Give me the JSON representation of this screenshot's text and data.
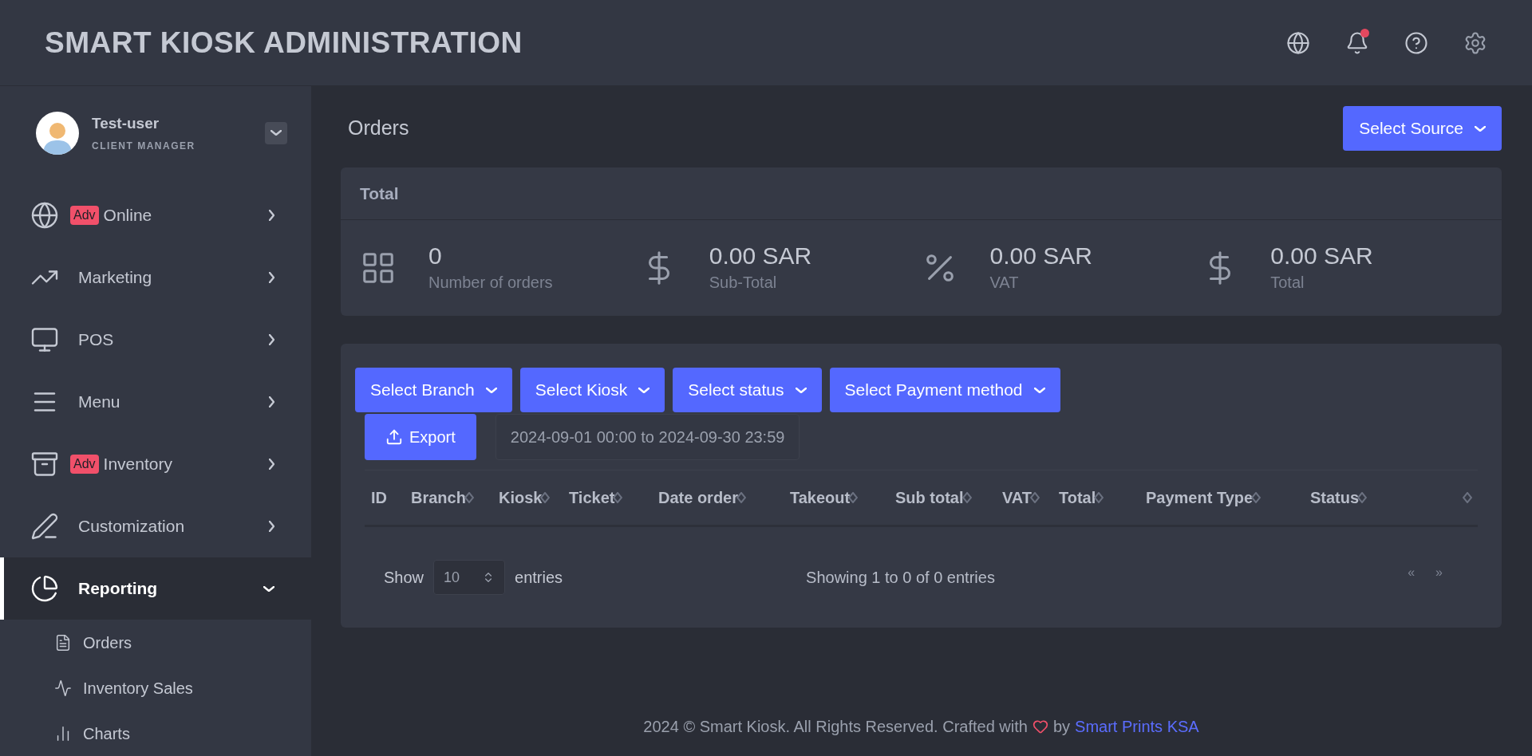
{
  "header": {
    "title": "SMART KIOSK ADMINISTRATION",
    "notification": true
  },
  "sidebar": {
    "user": {
      "name": "Test-user",
      "role": "CLIENT MANAGER"
    },
    "items": [
      {
        "label": "Online",
        "badge": "Adv",
        "selected": false,
        "expanded": false
      },
      {
        "label": "Marketing",
        "selected": false,
        "expanded": false
      },
      {
        "label": "POS",
        "selected": false,
        "expanded": false
      },
      {
        "label": "Menu",
        "selected": false,
        "expanded": false
      },
      {
        "label": "Inventory",
        "badge": "Adv",
        "selected": false,
        "expanded": false
      },
      {
        "label": "Customization",
        "selected": false,
        "expanded": false
      },
      {
        "label": "Reporting",
        "selected": true,
        "expanded": true,
        "children": [
          {
            "label": "Orders"
          },
          {
            "label": "Inventory Sales"
          },
          {
            "label": "Charts"
          }
        ]
      }
    ]
  },
  "page": {
    "title": "Orders",
    "source_button": "Select Source"
  },
  "totals": {
    "title": "Total",
    "stats": [
      {
        "value": "0",
        "label": "Number of orders"
      },
      {
        "value": "0.00 SAR",
        "label": "Sub-Total"
      },
      {
        "value": "0.00 SAR",
        "label": "VAT"
      },
      {
        "value": "0.00 SAR",
        "label": "Total"
      }
    ]
  },
  "filters": [
    "Select Branch",
    "Select Kiosk",
    "Select status",
    "Select Payment method"
  ],
  "export_button": "Export",
  "date_range": "2024-09-01 00:00 to 2024-09-30 23:59",
  "table": {
    "columns": [
      {
        "label": "ID",
        "sortable": false
      },
      {
        "label": "Branch",
        "sortable": true
      },
      {
        "label": "Kiosk",
        "sortable": true
      },
      {
        "label": "Ticket",
        "sortable": true
      },
      {
        "label": "Date order",
        "sortable": true
      },
      {
        "label": "Takeout",
        "sortable": true
      },
      {
        "label": "Sub total",
        "sortable": true
      },
      {
        "label": "VAT",
        "sortable": true
      },
      {
        "label": "Total",
        "sortable": true
      },
      {
        "label": "Payment Type",
        "sortable": true
      },
      {
        "label": "Status",
        "sortable": true
      },
      {
        "sortable": true
      }
    ]
  },
  "pagination": {
    "show": "Show",
    "page_size": "10",
    "entries": "entries",
    "info": "Showing 1 to 0 of 0 entries",
    "prev": "«",
    "next": "»"
  },
  "footer": {
    "text": "2024 © Smart Kiosk. All Rights Reserved. Crafted with",
    "by": "by",
    "link": "Smart Prints KSA"
  }
}
